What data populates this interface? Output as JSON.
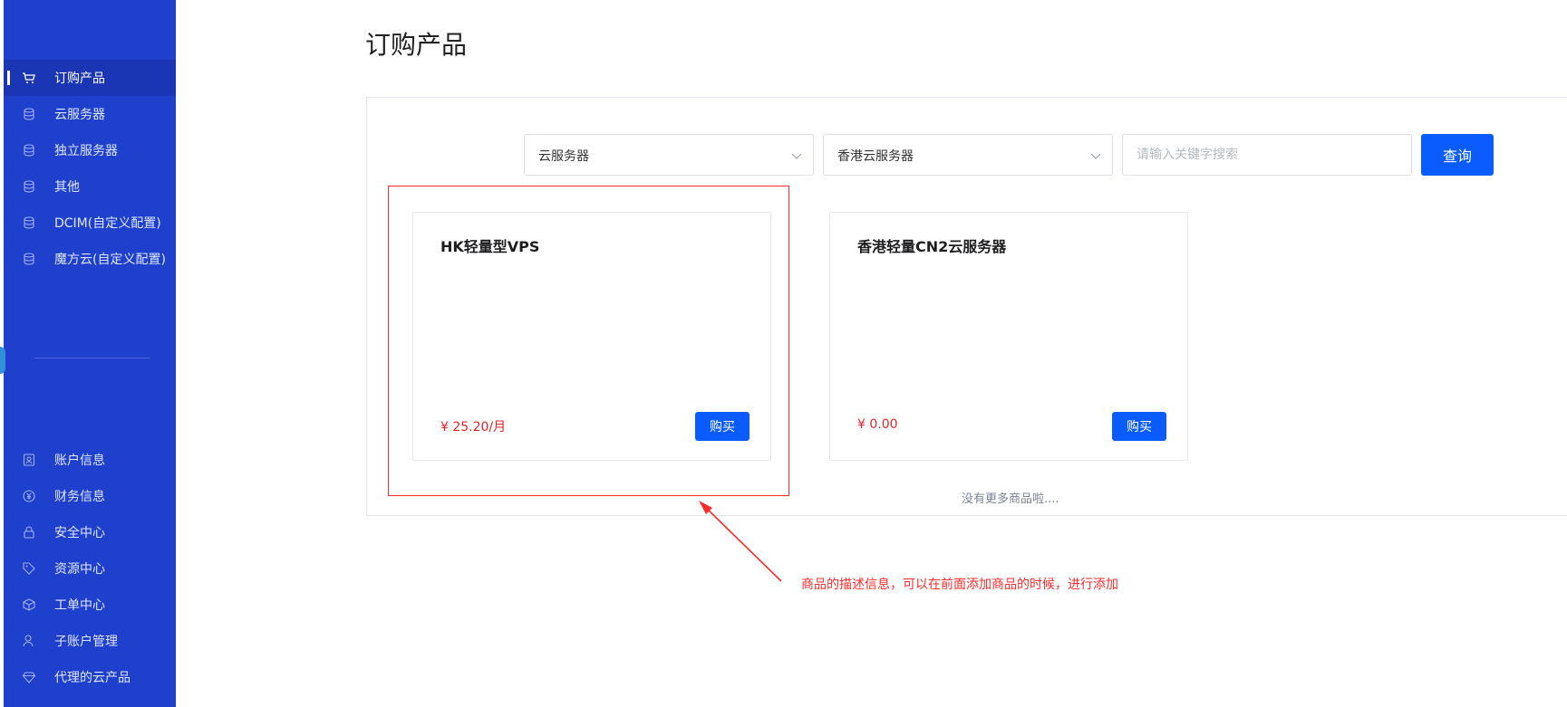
{
  "sidebar": {
    "top_items": [
      {
        "label": "订购产品",
        "icon": "cart-icon",
        "active": true
      },
      {
        "label": "云服务器",
        "icon": "database-icon"
      },
      {
        "label": "独立服务器",
        "icon": "database-icon"
      },
      {
        "label": "其他",
        "icon": "database-icon"
      },
      {
        "label": "DCIM(自定义配置)",
        "icon": "database-icon"
      },
      {
        "label": "魔方云(自定义配置)",
        "icon": "database-icon"
      }
    ],
    "bottom_items": [
      {
        "label": "账户信息",
        "icon": "id-card-icon"
      },
      {
        "label": "财务信息",
        "icon": "yen-coin-icon"
      },
      {
        "label": "安全中心",
        "icon": "lock-icon"
      },
      {
        "label": "资源中心",
        "icon": "tag-icon"
      },
      {
        "label": "工单中心",
        "icon": "box-icon"
      },
      {
        "label": "子账户管理",
        "icon": "user-icon"
      },
      {
        "label": "代理的云产品",
        "icon": "diamond-icon"
      }
    ]
  },
  "page": {
    "title": "订购产品"
  },
  "filters": {
    "category": "云服务器",
    "group": "香港云服务器",
    "search_placeholder": "请输入关键字搜索",
    "query_label": "查询"
  },
  "products": [
    {
      "name": "HK轻量型VPS",
      "price": "¥ 25.20/月",
      "buy_label": "购买"
    },
    {
      "name": "香港轻量CN2云服务器",
      "price": "¥ 0.00",
      "buy_label": "购买"
    }
  ],
  "no_more_text": "没有更多商品啦....",
  "annotation": {
    "text": "商品的描述信息，可以在前面添加商品的时候，进行添加"
  },
  "colors": {
    "sidebar": "#1f40cc",
    "primary": "#0b5cff",
    "price": "#e0252a",
    "annotation": "#ff2b2b"
  }
}
